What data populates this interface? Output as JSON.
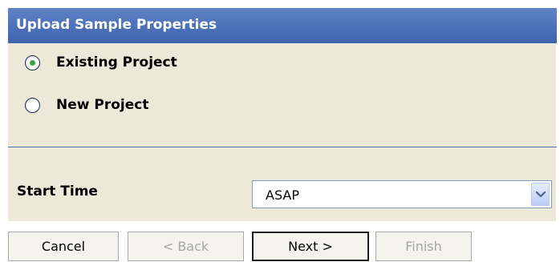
{
  "dialog": {
    "title": "Upload Sample Properties"
  },
  "project_type": {
    "options": [
      {
        "label": "Existing Project",
        "checked": true
      },
      {
        "label": "New Project",
        "checked": false
      }
    ]
  },
  "start_time": {
    "label": "Start Time",
    "selected_value": "ASAP",
    "dropdown_icon": "chevron-down-icon"
  },
  "buttons": {
    "cancel_label": "Cancel",
    "back_label": "< Back",
    "next_label": "Next >",
    "finish_label": "Finish"
  },
  "colors": {
    "title_bar": "#4a6fb5",
    "panel_background": "#ece9d8",
    "radio_selected_dot": "#3aa43a",
    "disabled_text": "#a6a6a6"
  }
}
